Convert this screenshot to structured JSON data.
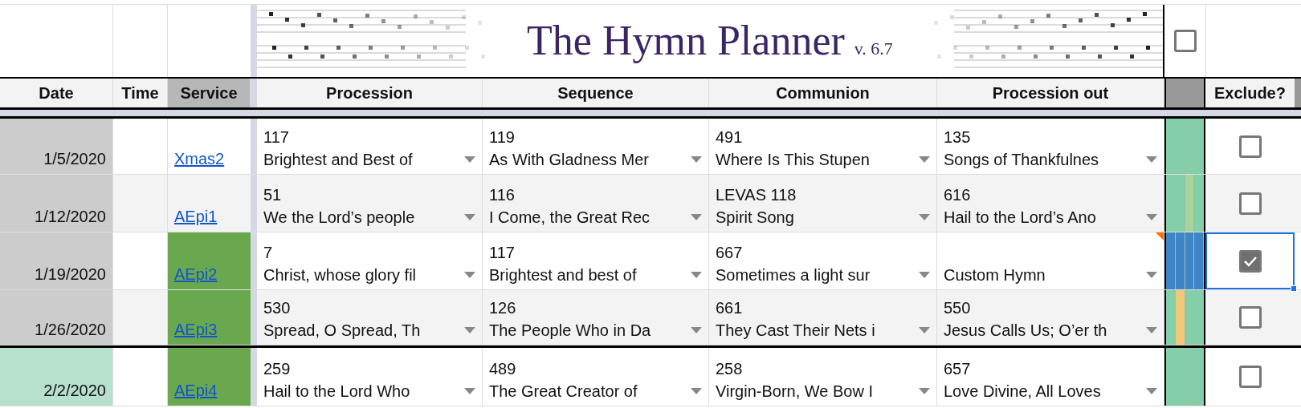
{
  "banner": {
    "title": "The Hymn Planner",
    "version": "v. 6.7",
    "checkbox": {
      "checked": false
    }
  },
  "columns": [
    {
      "label": "Date"
    },
    {
      "label": "Time"
    },
    {
      "label": "Service"
    },
    {
      "label": "Procession"
    },
    {
      "label": "Sequence"
    },
    {
      "label": "Communion"
    },
    {
      "label": "Procession out"
    },
    {
      "label": "Exclude?"
    }
  ],
  "rows": [
    {
      "date": {
        "text": "1/5/2020",
        "color": "#cccccc"
      },
      "service": {
        "text": "Xmas2",
        "color": "#ffffff"
      },
      "divider_above": false,
      "strip": [
        {
          "color": "#84cfaa"
        },
        {
          "color": "#84cfaa"
        },
        {
          "color": "#84cfaa"
        },
        {
          "color": "#84cfaa"
        }
      ],
      "hymns": [
        {
          "number": "117",
          "title": "Brightest and Best of",
          "note": false
        },
        {
          "number": "119",
          "title": "As With Gladness Mer",
          "note": false
        },
        {
          "number": "491",
          "title": "Where Is This Stupen",
          "note": false
        },
        {
          "number": "135",
          "title": "Songs of Thankfulnes",
          "note": false
        }
      ],
      "exclude": {
        "checked": false,
        "selected": false
      }
    },
    {
      "date": {
        "text": "1/12/2020",
        "color": "#cccccc"
      },
      "service": {
        "text": "AEpi1",
        "color": "#f3f3f3"
      },
      "divider_above": false,
      "strip": [
        {
          "color": "#84cfaa"
        },
        {
          "color": "#84cfaa"
        },
        {
          "color": "#a8d39a"
        },
        {
          "color": "#84cfaa"
        }
      ],
      "hymns": [
        {
          "number": "51",
          "title": "We the Lord’s people",
          "note": false
        },
        {
          "number": "116",
          "title": "I Come, the Great Rec",
          "note": false
        },
        {
          "number": "LEVAS 118",
          "title": "Spirit Song",
          "note": false
        },
        {
          "number": "616",
          "title": "Hail to the Lord’s Ano",
          "note": false
        }
      ],
      "exclude": {
        "checked": false,
        "selected": false
      }
    },
    {
      "date": {
        "text": "1/19/2020",
        "color": "#cccccc"
      },
      "service": {
        "text": "AEpi2",
        "color": "#6aa84f"
      },
      "divider_above": false,
      "strip": [
        {
          "color": "#3d85c6"
        },
        {
          "color": "#3d85c6"
        },
        {
          "color": "#3d85c6"
        },
        {
          "color": "#3d85c6"
        }
      ],
      "hymns": [
        {
          "number": "7",
          "title": "Christ, whose glory fil",
          "note": false
        },
        {
          "number": "117",
          "title": "Brightest and best of",
          "note": false
        },
        {
          "number": "667",
          "title": "Sometimes a light sur",
          "note": false
        },
        {
          "title": "Custom Hymn",
          "note": true
        }
      ],
      "exclude": {
        "checked": true,
        "selected": true
      }
    },
    {
      "date": {
        "text": "1/26/2020",
        "color": "#cccccc"
      },
      "service": {
        "text": "AEpi3",
        "color": "#6aa84f"
      },
      "divider_above": false,
      "strip": [
        {
          "color": "#84cfaa"
        },
        {
          "color": "#f1c878"
        },
        {
          "color": "#84cfaa"
        },
        {
          "color": "#84cfaa"
        }
      ],
      "hymns": [
        {
          "number": "530",
          "title": "Spread, O Spread, Th",
          "note": false
        },
        {
          "number": "126",
          "title": "The People Who in Da",
          "note": false
        },
        {
          "number": "661",
          "title": "They Cast Their Nets i",
          "note": false
        },
        {
          "number": "550",
          "title": "Jesus Calls Us; O’er th",
          "note": false
        }
      ],
      "exclude": {
        "checked": false,
        "selected": false
      }
    },
    {
      "date": {
        "text": "2/2/2020",
        "color": "#b7e1cd"
      },
      "service": {
        "text": "AEpi4",
        "color": "#6aa84f"
      },
      "divider_above": true,
      "strip": [
        {
          "color": "#84cfaa"
        },
        {
          "color": "#84cfaa"
        },
        {
          "color": "#84cfaa"
        },
        {
          "color": "#84cfaa"
        }
      ],
      "hymns": [
        {
          "number": "259",
          "title": "Hail to the Lord Who",
          "note": false
        },
        {
          "number": "489",
          "title": "The Great Creator of",
          "note": false
        },
        {
          "number": "258",
          "title": "Virgin-Born, We Bow I",
          "note": false
        },
        {
          "number": "657",
          "title": "Love Divine, All Loves",
          "note": false
        }
      ],
      "exclude": {
        "checked": false,
        "selected": false
      }
    }
  ]
}
